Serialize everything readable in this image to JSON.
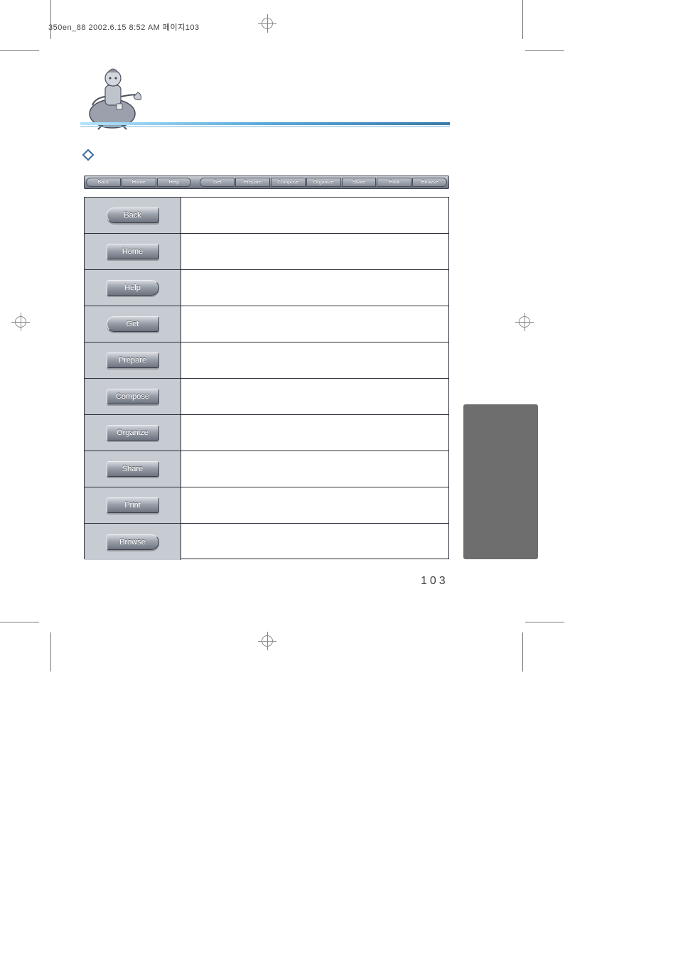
{
  "header": {
    "crop_info": "350en_88  2002.6.15 8:52 AM  페이지103"
  },
  "toolbar": {
    "items": [
      "Back",
      "Home",
      "Help",
      "Get",
      "Prepare",
      "Compose",
      "Organize",
      "Share",
      "Print",
      "Browse"
    ]
  },
  "table": {
    "rows": [
      {
        "label": "Back",
        "shape": "pill-round-left"
      },
      {
        "label": "Home",
        "shape": "pill-flat"
      },
      {
        "label": "Help",
        "shape": "pill-round-right"
      },
      {
        "label": "Get",
        "shape": "pill-round-left"
      },
      {
        "label": "Prepare",
        "shape": "pill-flat"
      },
      {
        "label": "Compose",
        "shape": "pill-flat"
      },
      {
        "label": "Organize",
        "shape": "pill-flat"
      },
      {
        "label": "Share",
        "shape": "pill-flat"
      },
      {
        "label": "Print",
        "shape": "pill-flat"
      },
      {
        "label": "Browse",
        "shape": "pill-round-right"
      }
    ]
  },
  "page_number": "103"
}
